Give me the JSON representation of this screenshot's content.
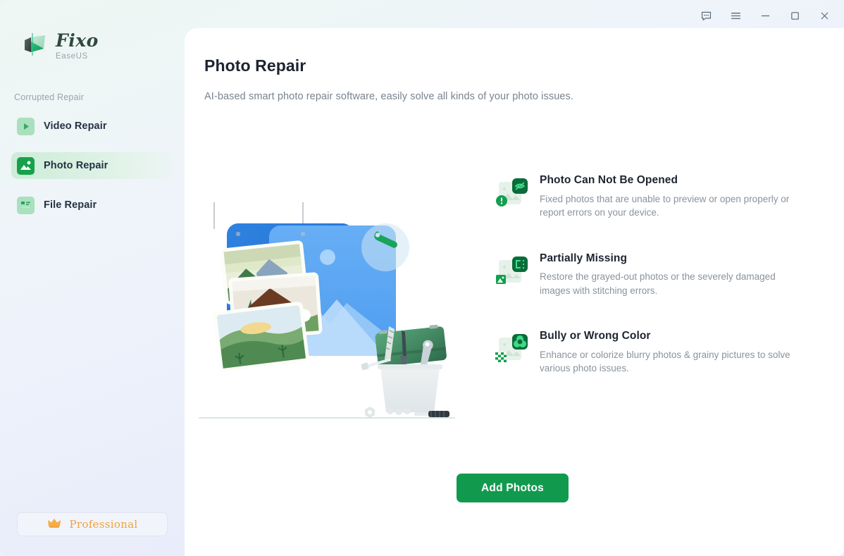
{
  "window": {
    "controls": [
      {
        "name": "feedback-icon",
        "label": "Feedback"
      },
      {
        "name": "menu-icon",
        "label": "Menu"
      },
      {
        "name": "minimize-icon",
        "label": "Minimize"
      },
      {
        "name": "maximize-icon",
        "label": "Maximize"
      },
      {
        "name": "close-icon",
        "label": "Close"
      }
    ]
  },
  "sidebar": {
    "brand": {
      "name": "Fixo",
      "sub": "EaseUS"
    },
    "section_label": "Corrupted Repair",
    "items": [
      {
        "label": "Video Repair",
        "icon": "video-repair-icon",
        "active": false
      },
      {
        "label": "Photo Repair",
        "icon": "photo-repair-icon",
        "active": true
      },
      {
        "label": "File Repair",
        "icon": "file-repair-icon",
        "active": false
      }
    ],
    "pro_button": {
      "label": "Professional",
      "icon": "crown-icon"
    }
  },
  "main": {
    "title": "Photo Repair",
    "subtitle": "AI-based smart photo repair software, easily solve all kinds of your photo issues.",
    "illustration": "photo-repair-illustration",
    "features": [
      {
        "icon": "photo-cannot-open-icon",
        "title": "Photo Can Not Be Opened",
        "desc": "Fixed photos that are unable to preview or open properly or report errors on your device."
      },
      {
        "icon": "partially-missing-icon",
        "title": "Partially Missing",
        "desc": "Restore the grayed-out photos or the severely damaged images with stitching errors."
      },
      {
        "icon": "wrong-color-icon",
        "title": "Bully or Wrong Color",
        "desc": "Enhance or colorize blurry photos & grainy pictures to solve various photo issues."
      }
    ],
    "cta": {
      "label": "Add Photos"
    }
  },
  "colors": {
    "accent_green": "#119a4e",
    "icon_green": "#17a24a",
    "pro_orange": "#f0a33c",
    "panel_white": "#ffffff",
    "text_dark": "#1d2430",
    "text_muted": "#8a939c"
  }
}
